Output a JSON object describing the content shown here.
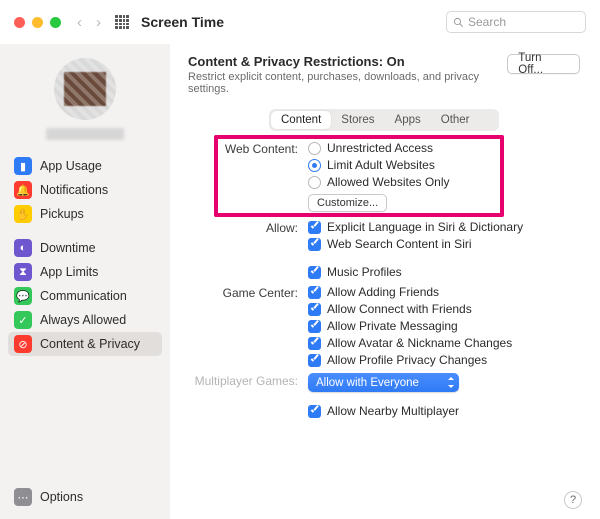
{
  "window": {
    "title": "Screen Time"
  },
  "search": {
    "placeholder": "Search"
  },
  "sidebar": {
    "items": [
      {
        "label": "App Usage",
        "iconBg": "#2f7bf6",
        "glyph": "▮"
      },
      {
        "label": "Notifications",
        "iconBg": "#ff3b30",
        "glyph": "🔔"
      },
      {
        "label": "Pickups",
        "iconBg": "#ffcc00",
        "glyph": "✋"
      },
      {
        "label": "Downtime",
        "iconBg": "#6e56cf",
        "glyph": "◐"
      },
      {
        "label": "App Limits",
        "iconBg": "#6e56cf",
        "glyph": "⧗"
      },
      {
        "label": "Communication",
        "iconBg": "#34c759",
        "glyph": "💬"
      },
      {
        "label": "Always Allowed",
        "iconBg": "#34c759",
        "glyph": "✓"
      },
      {
        "label": "Content & Privacy",
        "iconBg": "#ff3b30",
        "glyph": "⊘"
      }
    ],
    "options": {
      "label": "Options"
    }
  },
  "header": {
    "title_prefix": "Content & Privacy Restrictions: ",
    "title_state": "On",
    "subtitle": "Restrict explicit content, purchases, downloads, and privacy settings.",
    "turn_off": "Turn Off..."
  },
  "tabs": [
    "Content",
    "Stores",
    "Apps",
    "Other"
  ],
  "web_content": {
    "label": "Web Content:",
    "options": [
      "Unrestricted Access",
      "Limit Adult Websites",
      "Allowed Websites Only"
    ],
    "selected": "Limit Adult Websites",
    "customize": "Customize..."
  },
  "allow": {
    "label": "Allow:",
    "items": [
      "Explicit Language in Siri & Dictionary",
      "Web Search Content in Siri",
      "Music Profiles"
    ]
  },
  "game_center": {
    "label": "Game Center:",
    "items": [
      "Allow Adding Friends",
      "Allow Connect with Friends",
      "Allow Private Messaging",
      "Allow Avatar & Nickname Changes",
      "Allow Profile Privacy Changes"
    ]
  },
  "multiplayer": {
    "label": "Multiplayer Games:",
    "popup": "Allow with Everyone",
    "nearby": "Allow Nearby Multiplayer"
  }
}
